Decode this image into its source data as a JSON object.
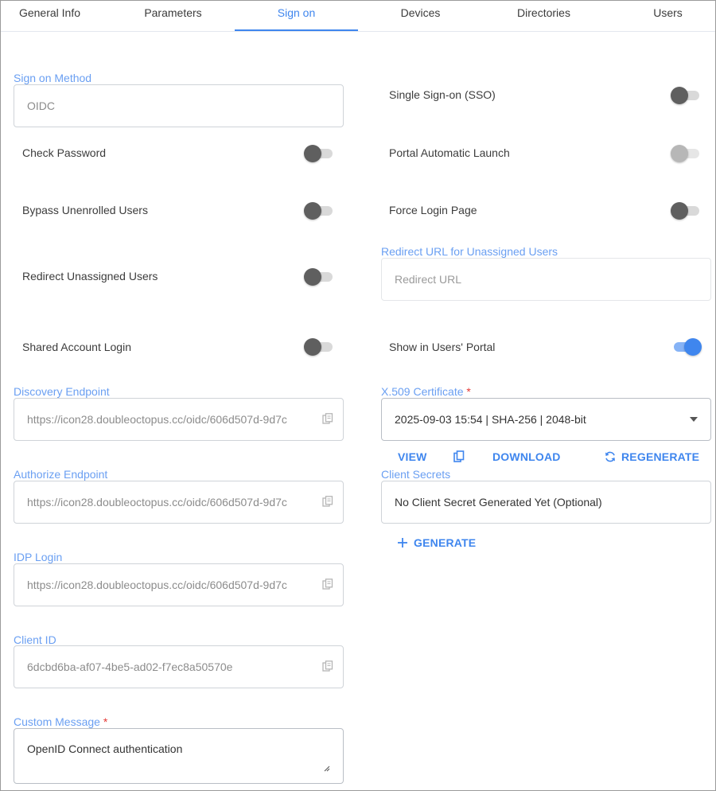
{
  "tabs": [
    {
      "label": "General Info"
    },
    {
      "label": "Parameters"
    },
    {
      "label": "Sign on"
    },
    {
      "label": "Devices"
    },
    {
      "label": "Directories"
    },
    {
      "label": "Users"
    }
  ],
  "active_tab": "Sign on",
  "sign_on_method": {
    "label": "Sign on Method",
    "value": "OIDC"
  },
  "toggles": {
    "sso": {
      "label": "Single Sign-on (SSO)",
      "state": "off"
    },
    "check_password": {
      "label": "Check Password",
      "state": "off"
    },
    "portal_auto_launch": {
      "label": "Portal Automatic Launch",
      "state": "off-disabled"
    },
    "bypass_unenrolled": {
      "label": "Bypass Unenrolled Users",
      "state": "off"
    },
    "force_login_page": {
      "label": "Force Login Page",
      "state": "off"
    },
    "redirect_unassigned": {
      "label": "Redirect Unassigned Users",
      "state": "off"
    },
    "shared_account_login": {
      "label": "Shared Account Login",
      "state": "off"
    },
    "show_in_portal": {
      "label": "Show in Users' Portal",
      "state": "on"
    }
  },
  "redirect_url": {
    "label": "Redirect URL for Unassigned Users",
    "placeholder": "Redirect URL"
  },
  "discovery_endpoint": {
    "label": "Discovery Endpoint",
    "value": "https://icon28.doubleoctopus.cc/oidc/606d507d-9d7c"
  },
  "authorize_endpoint": {
    "label": "Authorize Endpoint",
    "value": "https://icon28.doubleoctopus.cc/oidc/606d507d-9d7c"
  },
  "idp_login": {
    "label": "IDP Login",
    "value": "https://icon28.doubleoctopus.cc/oidc/606d507d-9d7c"
  },
  "client_id": {
    "label": "Client ID",
    "value": "6dcbd6ba-af07-4be5-ad02-f7ec8a50570e"
  },
  "custom_message": {
    "label": "Custom Message",
    "required": "*",
    "value": "OpenID Connect authentication"
  },
  "certificate": {
    "label": "X.509 Certificate",
    "required": "*",
    "value": "2025-09-03 15:54 | SHA-256 | 2048-bit",
    "view_label": "VIEW",
    "download_label": "DOWNLOAD",
    "regenerate_label": "REGENERATE"
  },
  "client_secrets": {
    "label": "Client Secrets",
    "value": "No Client Secret Generated Yet (Optional)",
    "generate_label": "GENERATE"
  },
  "colors": {
    "accent": "#3f86ee",
    "label": "#6a9ff2",
    "required": "#e53935"
  }
}
